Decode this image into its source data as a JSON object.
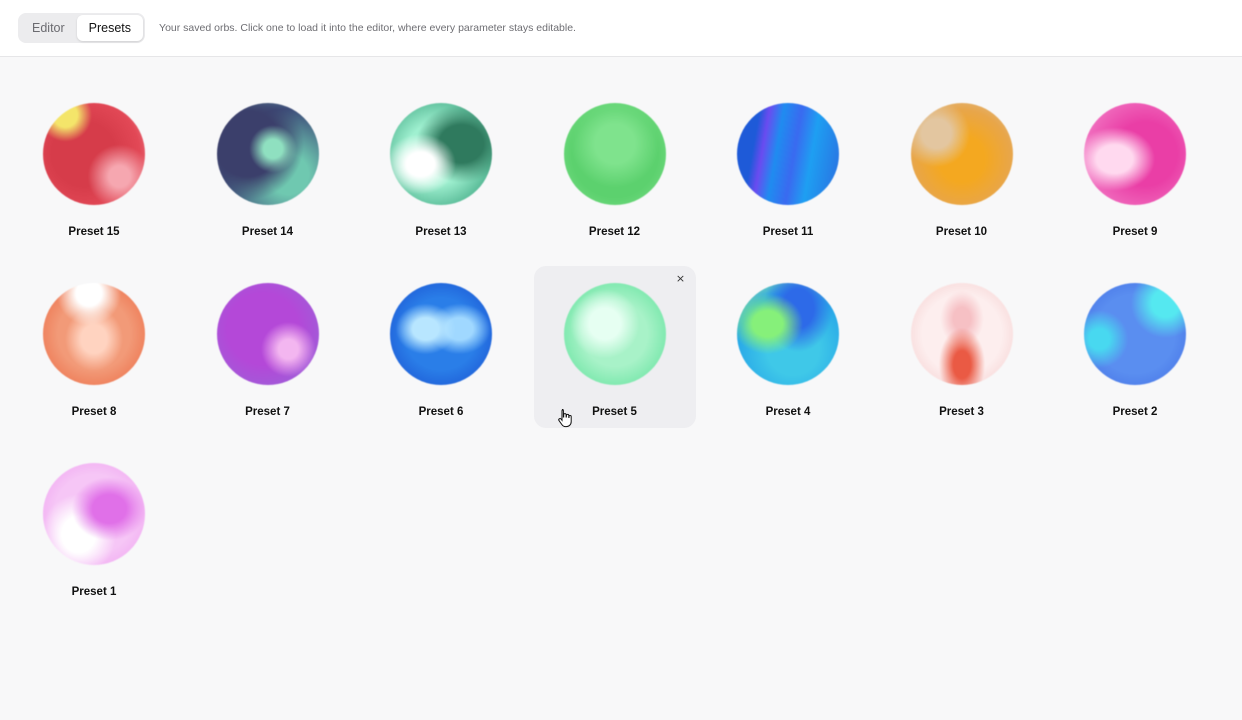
{
  "tabs": [
    {
      "label": "Editor",
      "active": false
    },
    {
      "label": "Presets",
      "active": true
    }
  ],
  "hint": "Your saved orbs. Click one to load it into the editor, where every parameter stays editable.",
  "presets": [
    {
      "label": "Preset 15",
      "look": "red"
    },
    {
      "label": "Preset 14",
      "look": "indigo-teal"
    },
    {
      "label": "Preset 13",
      "look": "mint-green"
    },
    {
      "label": "Preset 12",
      "look": "green"
    },
    {
      "label": "Preset 11",
      "look": "blue-violet"
    },
    {
      "label": "Preset 10",
      "look": "amber"
    },
    {
      "label": "Preset 9",
      "look": "pink"
    },
    {
      "label": "Preset 8",
      "look": "peach"
    },
    {
      "label": "Preset 7",
      "look": "purple"
    },
    {
      "label": "Preset 6",
      "look": "blue"
    },
    {
      "label": "Preset 5",
      "look": "mint",
      "hovered": true
    },
    {
      "label": "Preset 4",
      "look": "cyan-lime"
    },
    {
      "label": "Preset 3",
      "look": "blush-red"
    },
    {
      "label": "Preset 2",
      "look": "cornflower-cyan"
    },
    {
      "label": "Preset 1",
      "look": "lilac"
    }
  ],
  "delete_glyph": "×",
  "colors": {
    "background": "#f8f8f9",
    "topbar": "#ffffff",
    "hover_card": "#eeeef1",
    "text": "#111111",
    "muted_text": "#6e6e73"
  }
}
